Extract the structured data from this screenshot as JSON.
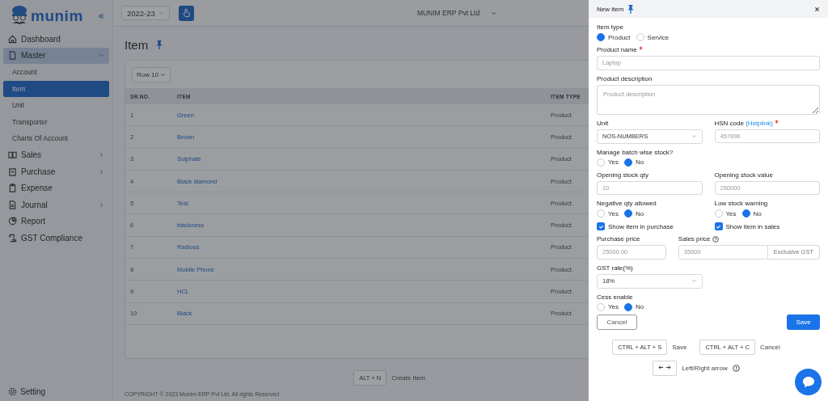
{
  "sidebar": {
    "logo": "munim",
    "items": [
      {
        "label": "Dashboard",
        "selected": false
      },
      {
        "label": "Master",
        "selected": true,
        "expanded": true,
        "children": [
          {
            "label": "Account",
            "selected": false
          },
          {
            "label": "Item",
            "selected": true
          },
          {
            "label": "Unit",
            "selected": false
          },
          {
            "label": "Transporter",
            "selected": false
          },
          {
            "label": "Charts Of Account",
            "selected": false
          }
        ]
      },
      {
        "label": "Sales",
        "selected": false,
        "expanded": false
      },
      {
        "label": "Purchase",
        "selected": false,
        "expanded": false
      },
      {
        "label": "Expense",
        "selected": false
      },
      {
        "label": "Journal",
        "selected": false,
        "expanded": false
      },
      {
        "label": "Report",
        "selected": false
      },
      {
        "label": "GST Compliance",
        "selected": false
      }
    ],
    "footer": "Setting"
  },
  "topbar": {
    "year": "2022-23",
    "company": "MUNIM ERP Pvt Ltd"
  },
  "page": {
    "title": "Item",
    "rows_select": "Row 10",
    "columns": [
      "SR.NO.",
      "ITEM",
      "ITEM TYPE"
    ],
    "rows": [
      [
        "1",
        "Green",
        "Product"
      ],
      [
        "2",
        "Brown",
        "Product"
      ],
      [
        "3",
        "Sulphate",
        "Product"
      ],
      [
        "4",
        "Black diamond",
        "Product"
      ],
      [
        "5",
        "Test",
        "Product"
      ],
      [
        "6",
        "blackness",
        "Product"
      ],
      [
        "7",
        "Radious",
        "Product"
      ],
      [
        "8",
        "Mobile Phone",
        "Product"
      ],
      [
        "9",
        "HCL",
        "Product"
      ],
      [
        "10",
        "Black",
        "Product"
      ]
    ],
    "shortcut": {
      "key": "ALT + N",
      "label": "Create Item"
    },
    "copyright": "COPYRIGHT © 2023 Munim ERP Pvt Ltd. All rights Reserved"
  },
  "drawer": {
    "title": "New item",
    "rows": [
      [
        {
          "kind": "radio",
          "label": "Item type",
          "options": [
            {
              "label": "Product",
              "selected": true
            },
            {
              "label": "Service",
              "selected": false
            }
          ]
        }
      ],
      [
        {
          "kind": "text",
          "label": "Product name",
          "required": true,
          "placeholder": "Laptop"
        }
      ],
      [
        {
          "kind": "textarea",
          "label": "Product description",
          "placeholder": "Product description"
        }
      ],
      [
        {
          "kind": "select",
          "label": "Unit",
          "value": "NOS-NUMBERS"
        },
        {
          "kind": "text",
          "label": "HSN code",
          "link": "(Helplink)",
          "required": true,
          "placeholder": "457896"
        }
      ],
      [
        {
          "kind": "radio",
          "label": "Manage batch wise stock?",
          "options": [
            {
              "label": "Yes",
              "selected": false
            },
            {
              "label": "No",
              "selected": true
            }
          ]
        }
      ],
      [
        {
          "kind": "text",
          "label": "Opening stock qty",
          "placeholder": "10"
        },
        {
          "kind": "text",
          "label": "Opening stock value",
          "placeholder": "250000"
        }
      ],
      [
        {
          "kind": "radio",
          "label": "Negative qty allowed",
          "options": [
            {
              "label": "Yes",
              "selected": false
            },
            {
              "label": "No",
              "selected": true
            }
          ]
        },
        {
          "kind": "radio",
          "label": "Low stock warning",
          "options": [
            {
              "label": "Yes",
              "selected": false
            },
            {
              "label": "No",
              "selected": true
            }
          ]
        }
      ],
      [
        {
          "kind": "checkbox",
          "label": "Show item in purchase",
          "checked": true
        },
        {
          "kind": "checkbox",
          "label": "Show item in sales",
          "checked": true
        }
      ],
      [
        {
          "kind": "text",
          "label": "Purchase price",
          "placeholder": "25000.00"
        },
        {
          "kind": "addon",
          "label": "Sales price",
          "help": true,
          "placeholder": "35000",
          "addon": "Exclusive GST"
        }
      ],
      [
        {
          "kind": "select",
          "label": "GST rate(%)",
          "value": "18%"
        }
      ],
      [
        {
          "kind": "radio",
          "label": "Cess enable",
          "options": [
            {
              "label": "Yes",
              "selected": false
            },
            {
              "label": "No",
              "selected": true
            }
          ]
        }
      ]
    ],
    "cancel": "Cancel",
    "save": "Save",
    "shortcuts": [
      {
        "key": "CTRL + ALT + S",
        "label": "Save"
      },
      {
        "key": "CTRL + ALT + C",
        "label": "Cancel"
      }
    ],
    "arrow_hint": "Left/Right arrow"
  }
}
